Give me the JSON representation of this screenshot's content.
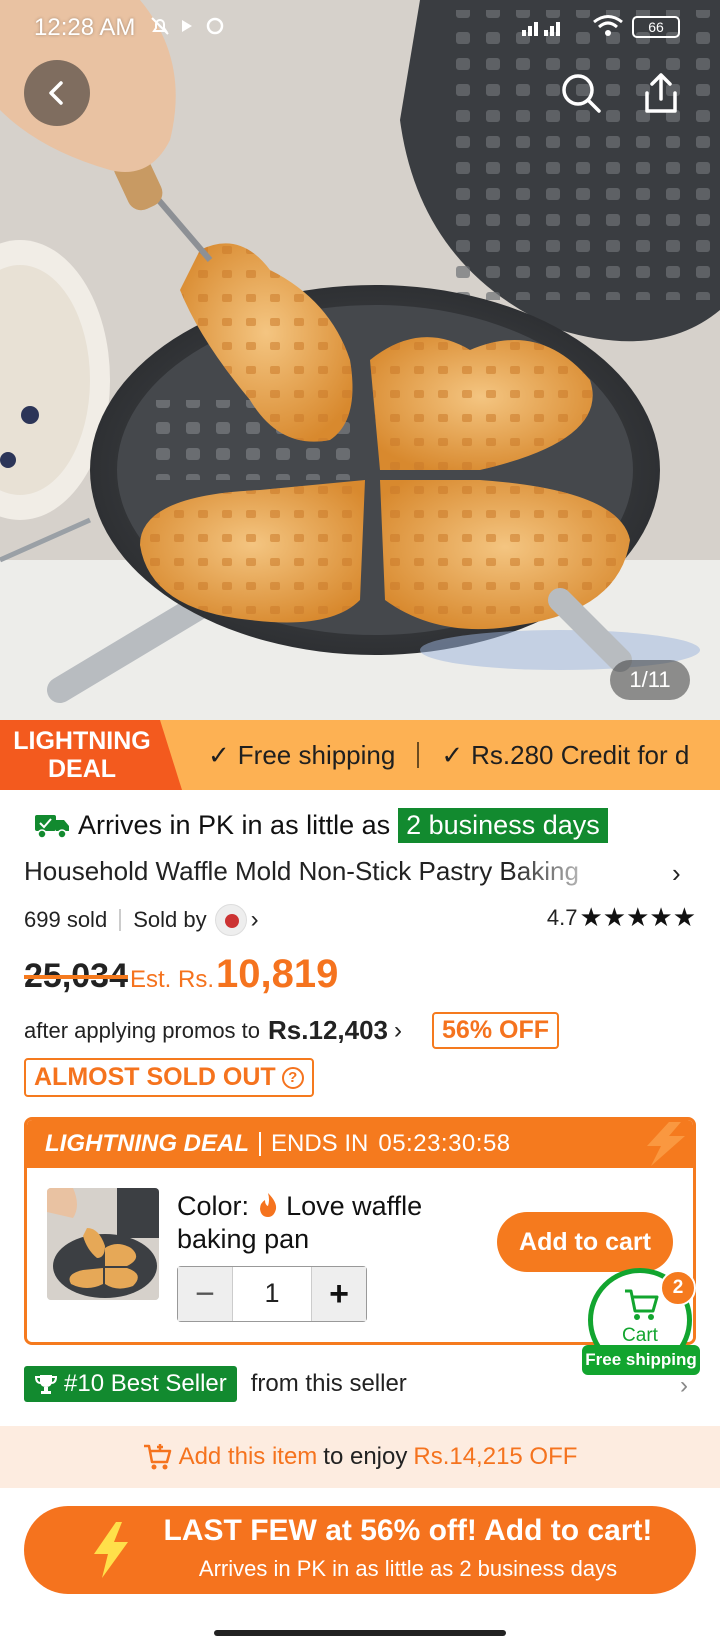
{
  "status_bar": {
    "time": "12:28 AM",
    "battery": "66"
  },
  "gallery": {
    "counter": "1/11"
  },
  "promo_strip": {
    "badge_line1": "LIGHTNING",
    "badge_line2": "DEAL",
    "items": [
      "Free shipping",
      "Rs.280 Credit for d"
    ]
  },
  "delivery": {
    "prefix": "Arrives in PK in as little as",
    "highlight": "2 business days"
  },
  "product": {
    "title": "Household Waffle Mold Non-Stick Pastry Baking",
    "sold": "699 sold",
    "sold_by": "Sold by",
    "rating": "4.7",
    "stars": "★★★★★",
    "old_price": "25,034",
    "est_label": "Est. Rs.",
    "price": "10,819",
    "after_promo_text": "after applying promos to",
    "after_promo_price": "Rs.12,403",
    "off_badge": "56% OFF",
    "almost_sold_out": "ALMOST SOLD OUT",
    "help_mark": "?"
  },
  "deal": {
    "label": "LIGHTNING DEAL",
    "ends_label": "ENDS IN",
    "timer": "05:23:30:58",
    "color_label": "Color:",
    "color_value": "Love waffle baking pan",
    "quantity": "1",
    "minus": "−",
    "plus": "+",
    "add_to_cart": "Add to cart"
  },
  "floating_cart": {
    "label": "Cart",
    "count": "2",
    "tag": "Free shipping"
  },
  "best_seller": {
    "badge": "#10 Best Seller",
    "text": "from this seller"
  },
  "bottom_promo": {
    "part1": "Add this item",
    "part2": "to enjoy",
    "part3": "Rs.14,215 OFF"
  },
  "cta": {
    "main": "LAST FEW at 56% off! Add to cart!",
    "sub": "Arrives in PK in as little as 2 business days"
  },
  "colors": {
    "orange": "#f5731e",
    "green": "#128a2f",
    "strip": "#fdb153"
  },
  "icons": [
    "back-icon",
    "search-icon",
    "share-icon",
    "truck-icon",
    "check-icon",
    "chevron-right-icon",
    "question-icon",
    "flame-icon",
    "cart-icon",
    "trophy-icon",
    "cart-plus-icon",
    "bolt-icon"
  ]
}
